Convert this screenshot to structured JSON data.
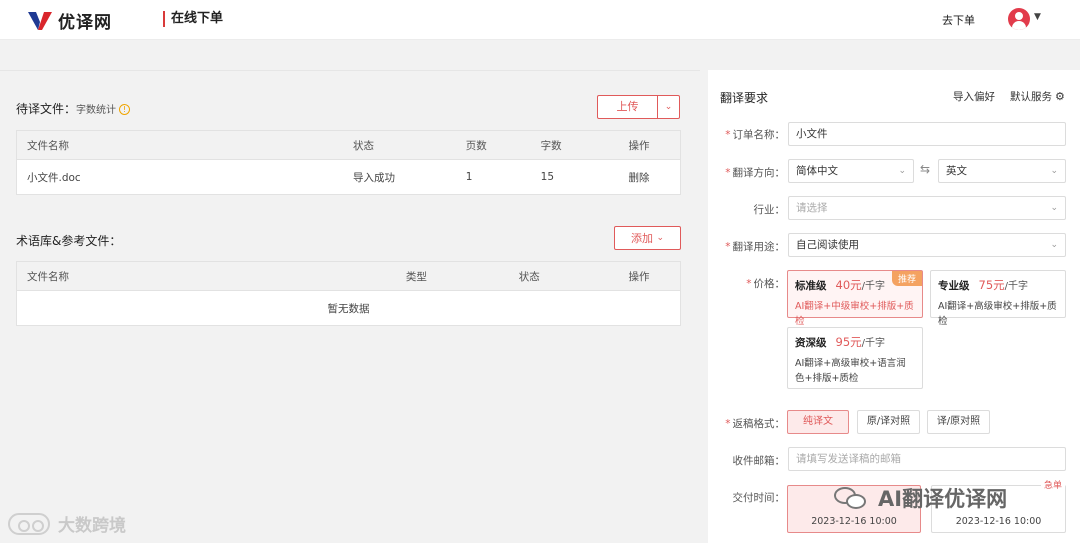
{
  "header": {
    "logo_text": "优译网",
    "page_title": "在线下单",
    "goto_order": "去下单"
  },
  "pending_files": {
    "title": "待译文件：",
    "subtitle": "字数统计",
    "upload_label": "上传",
    "columns": [
      "文件名称",
      "状态",
      "页数",
      "字数",
      "操作"
    ],
    "rows": [
      {
        "name": "小文件.doc",
        "status": "导入成功",
        "pages": "1",
        "words": "15",
        "action": "删除"
      }
    ]
  },
  "reference_files": {
    "title": "术语库&参考文件：",
    "add_label": "添加",
    "columns": [
      "文件名称",
      "类型",
      "状态",
      "操作"
    ],
    "empty_text": "暂无数据"
  },
  "requirements": {
    "title": "翻译要求",
    "import_pref": "导入偏好",
    "default_service": "默认服务",
    "order_name_label": "订单名称：",
    "order_name_value": "小文件",
    "direction_label": "翻译方向：",
    "source_lang": "简体中文",
    "target_lang": "英文",
    "industry_label": "行业：",
    "industry_placeholder": "请选择",
    "purpose_label": "翻译用途：",
    "purpose_value": "自己阅读使用",
    "price_label": "价格：",
    "price_unit": "/千字",
    "plans": [
      {
        "name": "标准级",
        "price": "40元",
        "desc": "AI翻译+中级审校+排版+质检",
        "badge": "推荐",
        "selected": true
      },
      {
        "name": "专业级",
        "price": "75元",
        "desc": "AI翻译+高级审校+排版+质检",
        "badge": "",
        "selected": false
      },
      {
        "name": "资深级",
        "price": "95元",
        "desc": "AI翻译+高级审校+语言润色+排版+质检",
        "badge": "",
        "selected": false
      }
    ],
    "format_label": "返稿格式：",
    "formats": [
      {
        "label": "纯译文",
        "selected": true
      },
      {
        "label": "原/译对照",
        "selected": false
      },
      {
        "label": "译/原对照",
        "selected": false
      }
    ],
    "email_label": "收件邮箱：",
    "email_placeholder": "请填写发送译稿的邮箱",
    "time_label": "交付时间：",
    "time_badge": "急单",
    "times": [
      {
        "date": "2023-12-16 10:00",
        "selected": true
      },
      {
        "date": "2023-12-16 10:00",
        "selected": false
      }
    ]
  },
  "watermarks": {
    "left": "大数跨境",
    "right": "AI翻译优译网"
  },
  "colors": {
    "accent": "#e05a5a",
    "success": "#2a9d4b",
    "logo_red": "#d9262c",
    "logo_blue": "#1f3a93"
  },
  "icons": [
    "logo-icon",
    "avatar-icon",
    "chevron-down-icon",
    "info-icon",
    "swap-icon",
    "gear-icon",
    "wechat-icon"
  ]
}
